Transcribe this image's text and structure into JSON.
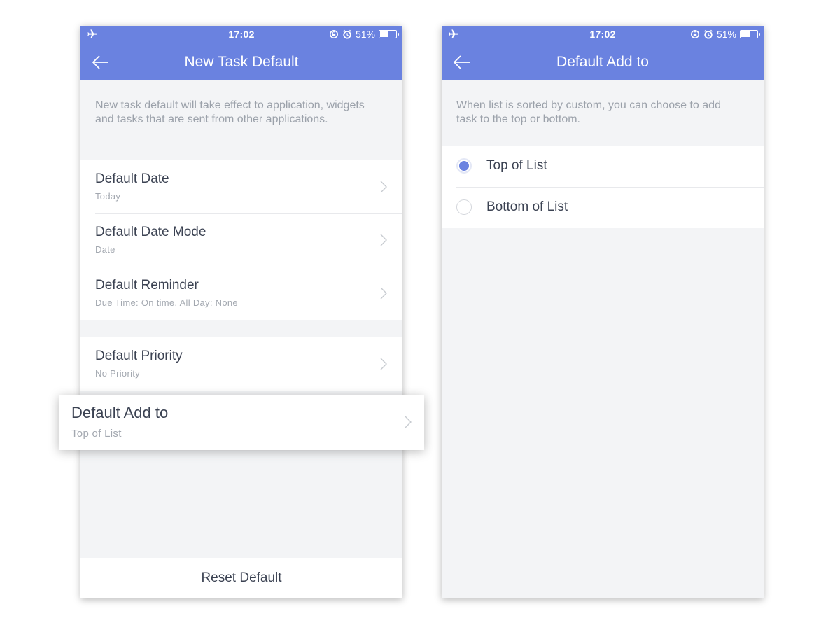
{
  "colors": {
    "accent": "#6a82e0",
    "background": "#f3f4f6",
    "text": "#3b4252",
    "muted": "#9ba1aa"
  },
  "status": {
    "time": "17:02",
    "battery": "51%",
    "battery_level": 0.51
  },
  "left": {
    "title": "New Task Default",
    "description": "New task default will take effect to application, widgets and tasks that are sent from other applications.",
    "group1": [
      {
        "title": "Default Date",
        "value": "Today"
      },
      {
        "title": "Default Date Mode",
        "value": "Date"
      },
      {
        "title": "Default Reminder",
        "value": "Due Time: On time. All Day: None"
      }
    ],
    "group2": [
      {
        "title": "Default Priority",
        "value": "No Priority"
      }
    ],
    "highlight": {
      "title": "Default Add to",
      "value": "Top of List"
    },
    "reset_label": "Reset Default"
  },
  "right": {
    "title": "Default Add to",
    "description": "When list is sorted by custom, you can choose to add task to the top or bottom.",
    "options": [
      {
        "label": "Top of List",
        "selected": true
      },
      {
        "label": "Bottom of List",
        "selected": false
      }
    ]
  }
}
